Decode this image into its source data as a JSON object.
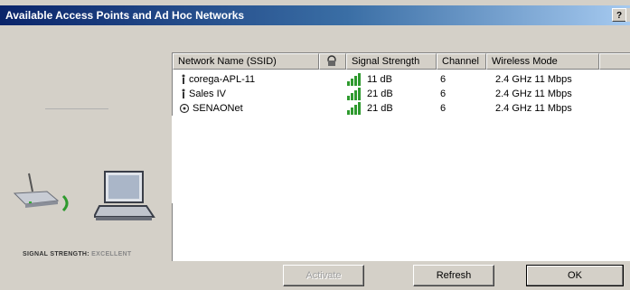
{
  "window": {
    "title": "Available Access Points and Ad Hoc Networks",
    "help_label": "?",
    "close_label": "X"
  },
  "left_panel": {
    "signal_strength_label": "SIGNAL STRENGTH:",
    "signal_strength_value": "EXCELLENT"
  },
  "list": {
    "columns": [
      "Network Name (SSID)",
      "",
      "Signal Strength",
      "Channel",
      "Wireless Mode"
    ],
    "rows": [
      {
        "ssid": "corega-APL-11",
        "signal": "11 dB",
        "channel": "6",
        "mode": "2.4 GHz 11 Mbps",
        "icon": "access-point-icon"
      },
      {
        "ssid": "Sales IV",
        "signal": "21 dB",
        "channel": "6",
        "mode": "2.4 GHz 11 Mbps",
        "icon": "access-point-icon"
      },
      {
        "ssid": "SENAONet",
        "signal": "21 dB",
        "channel": "6",
        "mode": "2.4 GHz 11 Mbps",
        "icon": "ad-hoc-icon"
      }
    ]
  },
  "buttons": {
    "activate": "Activate",
    "refresh": "Refresh",
    "ok": "OK"
  },
  "colors": {
    "title_gradient_start": "#0a246a",
    "title_gradient_end": "#a6caf0",
    "signal_green": "#2e9a2e",
    "dialog_bg": "#d4d0c8"
  }
}
